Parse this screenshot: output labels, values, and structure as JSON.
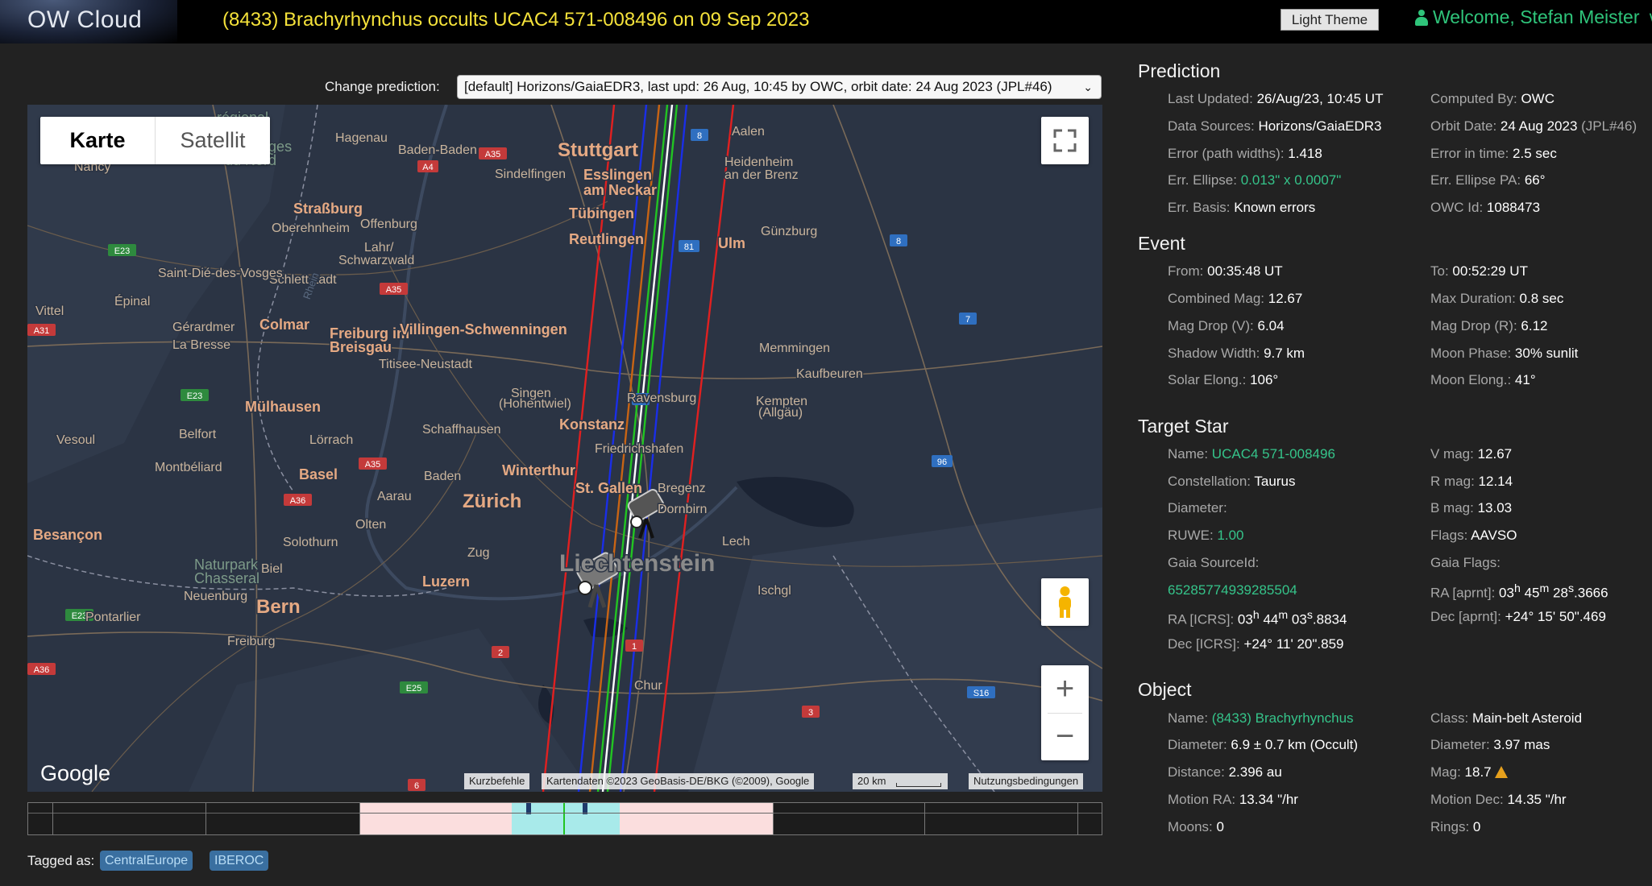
{
  "header": {
    "logo_text": "OW Cloud",
    "event_title": "(8433) Brachyrhynchus occults UCAC4 571-008496 on 09 Sep 2023",
    "theme_button": "Light Theme",
    "welcome": "Welcome, Stefan Meister",
    "chevron": "∨"
  },
  "prediction_selector": {
    "label": "Change prediction:",
    "selected": "[default] Horizons/GaiaEDR3, last upd: 26 Aug, 10:45 by OWC, orbit date: 24 Aug 2023 (JPL#46)",
    "arrow": "⌄"
  },
  "map": {
    "type_buttons": [
      "Karte",
      "Satellit"
    ],
    "google_logo": "Google",
    "attribution": [
      "Kurzbefehle",
      "Kartendaten ©2023 GeoBasis-DE/BKG (©2009), Google",
      "20 km",
      "Nutzungsbedingungen"
    ],
    "zoom_in": "+",
    "zoom_out": "−",
    "labels": [
      {
        "text": "Stuttgart",
        "cls": "big"
      },
      {
        "text": "Esslingen",
        "cls": "mid"
      },
      {
        "text": "am Neckar",
        "cls": "mid"
      },
      {
        "text": "Sindelfingen",
        "cls": "small"
      },
      {
        "text": "Tübingen",
        "cls": "mid"
      },
      {
        "text": "Reutlingen",
        "cls": "mid"
      },
      {
        "text": "Aalen",
        "cls": "small"
      },
      {
        "text": "Heidenheim",
        "cls": "small"
      },
      {
        "text": "an der Brenz",
        "cls": "small"
      },
      {
        "text": "Ulm",
        "cls": "mid"
      },
      {
        "text": "Günzburg",
        "cls": "small"
      },
      {
        "text": "Hagenau",
        "cls": "small"
      },
      {
        "text": "Baden-Baden",
        "cls": "small"
      },
      {
        "text": "Straßburg",
        "cls": "mid"
      },
      {
        "text": "Oberehnheim",
        "cls": "small"
      },
      {
        "text": "Offenburg",
        "cls": "small"
      },
      {
        "text": "Lahr/",
        "cls": "small"
      },
      {
        "text": "Schwarzwald",
        "cls": "small"
      },
      {
        "text": "Schlettstadt",
        "cls": "small"
      },
      {
        "text": "Saint-Dié-des-Vosges",
        "cls": "small"
      },
      {
        "text": "Nancy",
        "cls": "small"
      },
      {
        "text": "Épinal",
        "cls": "small"
      },
      {
        "text": "Vittel",
        "cls": "small"
      },
      {
        "text": "Gérardmer",
        "cls": "small"
      },
      {
        "text": "La Bresse",
        "cls": "small"
      },
      {
        "text": "Colmar",
        "cls": "mid"
      },
      {
        "text": "Freiburg im",
        "cls": "mid"
      },
      {
        "text": "Breisgau",
        "cls": "mid"
      },
      {
        "text": "Villingen-Schwenningen",
        "cls": "mid"
      },
      {
        "text": "Titisee-Neustadt",
        "cls": "small"
      },
      {
        "text": "Mülhausen",
        "cls": "mid"
      },
      {
        "text": "Belfort",
        "cls": "small"
      },
      {
        "text": "Montbéliard",
        "cls": "small"
      },
      {
        "text": "Vesoul",
        "cls": "small"
      },
      {
        "text": "Lörrach",
        "cls": "small"
      },
      {
        "text": "Basel",
        "cls": "mid"
      },
      {
        "text": "Schaffhausen",
        "cls": "small"
      },
      {
        "text": "Singen",
        "cls": "small"
      },
      {
        "text": "(Hohentwiel)",
        "cls": "small"
      },
      {
        "text": "Konstanz",
        "cls": "mid"
      },
      {
        "text": "Ravensburg",
        "cls": "small"
      },
      {
        "text": "Friedrichshafen",
        "cls": "small"
      },
      {
        "text": "Memmingen",
        "cls": "small"
      },
      {
        "text": "Kaufbeuren",
        "cls": "small"
      },
      {
        "text": "Kempten",
        "cls": "small"
      },
      {
        "text": "(Allgäu)",
        "cls": "small"
      },
      {
        "text": "Baden",
        "cls": "small"
      },
      {
        "text": "Winterthur",
        "cls": "mid"
      },
      {
        "text": "Zürich",
        "cls": "big"
      },
      {
        "text": "St. Gallen",
        "cls": "mid"
      },
      {
        "text": "Bregenz",
        "cls": "small"
      },
      {
        "text": "Dornbirn",
        "cls": "small"
      },
      {
        "text": "Aarau",
        "cls": "small"
      },
      {
        "text": "Olten",
        "cls": "small"
      },
      {
        "text": "Solothurn",
        "cls": "small"
      },
      {
        "text": "Zug",
        "cls": "small"
      },
      {
        "text": "Luzern",
        "cls": "mid"
      },
      {
        "text": "Liechtenstein",
        "cls": "country"
      },
      {
        "text": "Lech",
        "cls": "small"
      },
      {
        "text": "Ischgl",
        "cls": "small"
      },
      {
        "text": "Besançon",
        "cls": "mid"
      },
      {
        "text": "Naturpark",
        "cls": "park"
      },
      {
        "text": "Chasseral",
        "cls": "park"
      },
      {
        "text": "Biel",
        "cls": "small"
      },
      {
        "text": "Bern",
        "cls": "big"
      },
      {
        "text": "Neuenburg",
        "cls": "small"
      },
      {
        "text": "Pontarlier",
        "cls": "small"
      },
      {
        "text": "Freiburg",
        "cls": "small"
      },
      {
        "text": "Chur",
        "cls": "small"
      },
      {
        "text": "régional",
        "cls": "park"
      },
      {
        "text": "des Vosges",
        "cls": "park"
      },
      {
        "text": "du Nord",
        "cls": "park"
      },
      {
        "text": "Rhein",
        "cls": "river"
      }
    ],
    "shields": [
      "A4",
      "A35",
      "A35",
      "A35",
      "A36",
      "A31",
      "E23",
      "E23",
      "E23",
      "E25",
      "A36",
      "8",
      "81",
      "8",
      "7",
      "96",
      "8",
      "2",
      "3",
      "6",
      "S16",
      "1"
    ]
  },
  "timeline": {},
  "tags": {
    "label": "Tagged as:",
    "items": [
      "CentralEurope",
      "IBEROC"
    ]
  },
  "prediction": {
    "title": "Prediction",
    "left": [
      {
        "label": "Last Updated: ",
        "value": "26/Aug/23, 10:45 UT"
      },
      {
        "label": "Data Sources: ",
        "value": "Horizons/GaiaEDR3"
      },
      {
        "label": "Error (path widths): ",
        "value": "1.418"
      },
      {
        "label": "Err. Ellipse: ",
        "value": "0.013\" x 0.0007\""
      },
      {
        "label": "Err. Basis: ",
        "value": "Known errors"
      }
    ],
    "right": [
      {
        "label": "Computed By: ",
        "value": "OWC"
      },
      {
        "label": "Orbit Date: ",
        "value": "24 Aug 2023 ",
        "extra": "(JPL#46)"
      },
      {
        "label": "Error in time: ",
        "value": "2.5 sec"
      },
      {
        "label": "Err. Ellipse PA: ",
        "value": "66°"
      },
      {
        "label": "OWC Id: ",
        "value": "1088473"
      }
    ]
  },
  "event": {
    "title": "Event",
    "left": [
      {
        "label": "From: ",
        "value": "00:35:48 UT"
      },
      {
        "label": "Combined Mag: ",
        "value": "12.67"
      },
      {
        "label": "Mag Drop (V): ",
        "value": "6.04"
      },
      {
        "label": "Shadow Width: ",
        "value": "9.7 km"
      },
      {
        "label": "Solar Elong.: ",
        "value": "106°"
      }
    ],
    "right": [
      {
        "label": "To: ",
        "value": "00:52:29 UT"
      },
      {
        "label": "Max Duration: ",
        "value": "0.8 sec"
      },
      {
        "label": "Mag Drop (R): ",
        "value": "6.12"
      },
      {
        "label": "Moon Phase: ",
        "value": "30% sunlit"
      },
      {
        "label": "Moon Elong.: ",
        "value": "41°"
      }
    ]
  },
  "target_star": {
    "title": "Target Star",
    "name_label": "Name: ",
    "name_value": "UCAC4 571-008496",
    "constellation_label": "Constellation: ",
    "constellation_value": "Taurus",
    "diameter_label": "Diameter:",
    "ruwe_label": "RUWE: ",
    "ruwe_value": "1.00",
    "gaia_label": "Gaia SourceId:",
    "gaia_value": "65285774939285504",
    "ra_label": "RA [ICRS]: ",
    "ra_h": "03",
    "ra_m": "44",
    "ra_s": "03",
    "ra_frac": ".8834",
    "dec_label": "Dec [ICRS]: ",
    "dec_d": "+24° 11",
    "dec_m": "20",
    "dec_frac": ".859",
    "right": [
      {
        "label": "V mag: ",
        "value": "12.67"
      },
      {
        "label": "R mag: ",
        "value": "12.14"
      },
      {
        "label": "B mag: ",
        "value": "13.03"
      },
      {
        "label": "Flags: ",
        "value": "AAVSO"
      },
      {
        "label": "Gaia Flags:",
        "value": ""
      }
    ],
    "ra_aprnt_label": "RA [aprnt]: ",
    "ra_aprnt_h": "03",
    "ra_aprnt_m": "45",
    "ra_aprnt_s": "28",
    "ra_aprnt_frac": ".3666",
    "dec_aprnt_label": "Dec [aprnt]: ",
    "dec_aprnt_d": "+24° 15",
    "dec_aprnt_m": "50",
    "dec_aprnt_frac": ".469"
  },
  "object": {
    "title": "Object",
    "left": [
      {
        "label": "Name: ",
        "value": "(8433) Brachyrhynchus",
        "green": true
      },
      {
        "label": "Diameter: ",
        "value": "6.9 ± 0.7 km  (Occult)"
      },
      {
        "label": "Distance: ",
        "value": "2.396 au"
      },
      {
        "label": "Motion RA: ",
        "value": "13.34 \"/hr"
      },
      {
        "label": "Moons: ",
        "value": "0"
      }
    ],
    "right": [
      {
        "label": "Class: ",
        "value": "Main-belt Asteroid"
      },
      {
        "label": "Diameter: ",
        "value": "3.97 mas"
      },
      {
        "label": "Mag: ",
        "value": "18.7"
      },
      {
        "label": "Motion Dec: ",
        "value": "14.35 \"/hr"
      },
      {
        "label": "Rings: ",
        "value": "0"
      }
    ]
  },
  "colors": {
    "path_outer": "#e02020",
    "path_error": "#1a2ee8",
    "path_center": "#ffffff",
    "path_shadow": "#22c422",
    "path_extra": "#c86414",
    "accent_green": "#35c48a",
    "title_yellow": "#f5e23a"
  }
}
